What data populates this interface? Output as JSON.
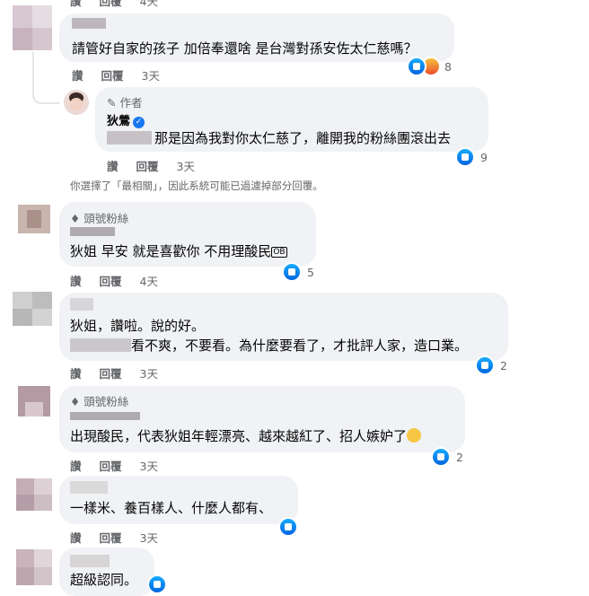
{
  "actions": {
    "like": "讚",
    "reply": "回覆"
  },
  "comments": [
    {
      "id": "c0",
      "time": "4天"
    },
    {
      "id": "c1",
      "text": "請管好自家的孩子 加倍奉還啥 是台灣對孫安佐太仁慈嗎？",
      "time": "3天",
      "reactions": "8"
    },
    {
      "id": "r1",
      "author_tag": "作者",
      "author": "狄鶯",
      "text": "那是因為我對你太仁慈了，離開我的粉絲團滾出去",
      "time": "3天",
      "reactions": "9"
    },
    {
      "id": "c2",
      "badge": "頭號粉絲",
      "text": "狄姐 早安 就是喜歡你 不用理酸民",
      "text_suffix": "OB",
      "time": "4天",
      "reactions": "5"
    },
    {
      "id": "c3",
      "text_line1": "狄姐，讚啦。說的好。",
      "text_line2": "看不爽，不要看。為什麼要看了，才批評人家，造口業。",
      "time": "3天",
      "reactions": "2"
    },
    {
      "id": "c4",
      "badge": "頭號粉絲",
      "text": "出現酸民，代表狄姐年輕漂亮、越來越紅了、招人嫉妒了",
      "time": "3天",
      "reactions": "2"
    },
    {
      "id": "c5",
      "text": "一樣米、養百樣人、什麼人都有、",
      "time": "3天"
    },
    {
      "id": "c6",
      "text": "超級認同。"
    }
  ],
  "filter_note": "你選擇了「最相關」，因此系統可能已過濾掉部分回覆。",
  "colors": {
    "like_blue": "#1877f2",
    "bubble_bg": "#f0f2f5",
    "meta_gray": "#65676b"
  }
}
